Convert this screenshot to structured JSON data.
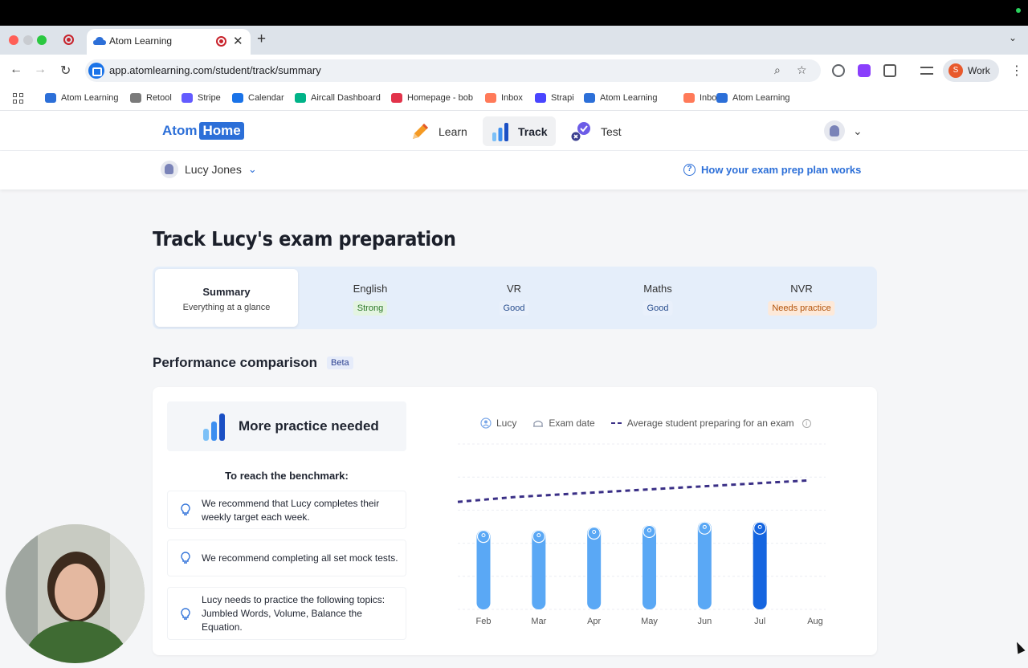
{
  "browser": {
    "tab_title": "Atom Learning",
    "url": "app.atomlearning.com/student/track/summary",
    "profile_initial": "S",
    "profile_label": "Work",
    "bookmarks": [
      {
        "label": "Atom Learning",
        "color": "#2c6fd8"
      },
      {
        "label": "Retool",
        "color": "#7a7a7a"
      },
      {
        "label": "Stripe",
        "color": "#635bff"
      },
      {
        "label": "Calendar",
        "color": "#1a73e8"
      },
      {
        "label": "Aircall Dashboard",
        "color": "#00b388"
      },
      {
        "label": "Homepage - bob",
        "color": "#e2334a"
      },
      {
        "label": "Inbox",
        "color": "#ff7a59"
      },
      {
        "label": "Strapi",
        "color": "#4945ff"
      },
      {
        "label": "Atom Learning",
        "color": "#2c6fd8"
      },
      {
        "label": "Inbox",
        "color": "#ff7a59"
      },
      {
        "label": "Atom Learning",
        "color": "#2c6fd8"
      }
    ]
  },
  "app": {
    "logo_atom": "Atom",
    "logo_home": "Home",
    "nav": [
      {
        "label": "Learn",
        "icon": "pencil-icon",
        "active": false
      },
      {
        "label": "Track",
        "icon": "bar-chart-icon",
        "active": true
      },
      {
        "label": "Test",
        "icon": "test-check-icon",
        "active": false
      }
    ],
    "student_name": "Lucy Jones",
    "help_link": "How your exam prep plan works"
  },
  "page": {
    "title": "Track Lucy's exam preparation",
    "subjects": [
      {
        "name": "Summary",
        "desc": "Everything at a glance"
      },
      {
        "name": "English",
        "badge": "Strong",
        "badge_bg": "#e4f4e1",
        "badge_fg": "#2f7a2a"
      },
      {
        "name": "VR",
        "badge": "Good",
        "badge_bg": "#e9f0fb",
        "badge_fg": "#2a4f8f"
      },
      {
        "name": "Maths",
        "badge": "Good",
        "badge_bg": "#e9f0fb",
        "badge_fg": "#2a4f8f"
      },
      {
        "name": "NVR",
        "badge": "Needs practice",
        "badge_bg": "#fde9d9",
        "badge_fg": "#b3530a"
      }
    ],
    "performance_heading": "Performance comparison",
    "beta_label": "Beta",
    "status": "More practice needed",
    "benchmark_heading": "To reach the benchmark:",
    "recommendations": [
      "We recommend that Lucy completes their weekly target each week.",
      "We recommend completing all set mock tests.",
      "Lucy needs to practice the following topics: Jumbled Words, Volume, Balance the Equation."
    ]
  },
  "chart_data": {
    "type": "bar",
    "legend": [
      {
        "label": "Lucy",
        "icon": "user-icon"
      },
      {
        "label": "Exam date",
        "icon": "exam-date-icon"
      },
      {
        "label": "Average student preparing for an exam",
        "icon": "dashed-line-icon"
      }
    ],
    "categories": [
      "Feb",
      "Mar",
      "Apr",
      "May",
      "Jun",
      "Jul",
      "Aug"
    ],
    "series": [
      {
        "name": "Lucy",
        "values": [
          48,
          48,
          50,
          51,
          53,
          53,
          null
        ],
        "highlight_index": 5
      },
      {
        "name": "Average student preparing for an exam",
        "type": "line",
        "values": [
          65,
          68,
          70,
          72,
          74,
          76,
          78
        ]
      }
    ],
    "ylim": [
      0,
      100
    ],
    "grid": true,
    "colors": {
      "bar": "#5aa8f5",
      "bar_highlight": "#1565e0",
      "average_line": "#3a2f86"
    }
  }
}
